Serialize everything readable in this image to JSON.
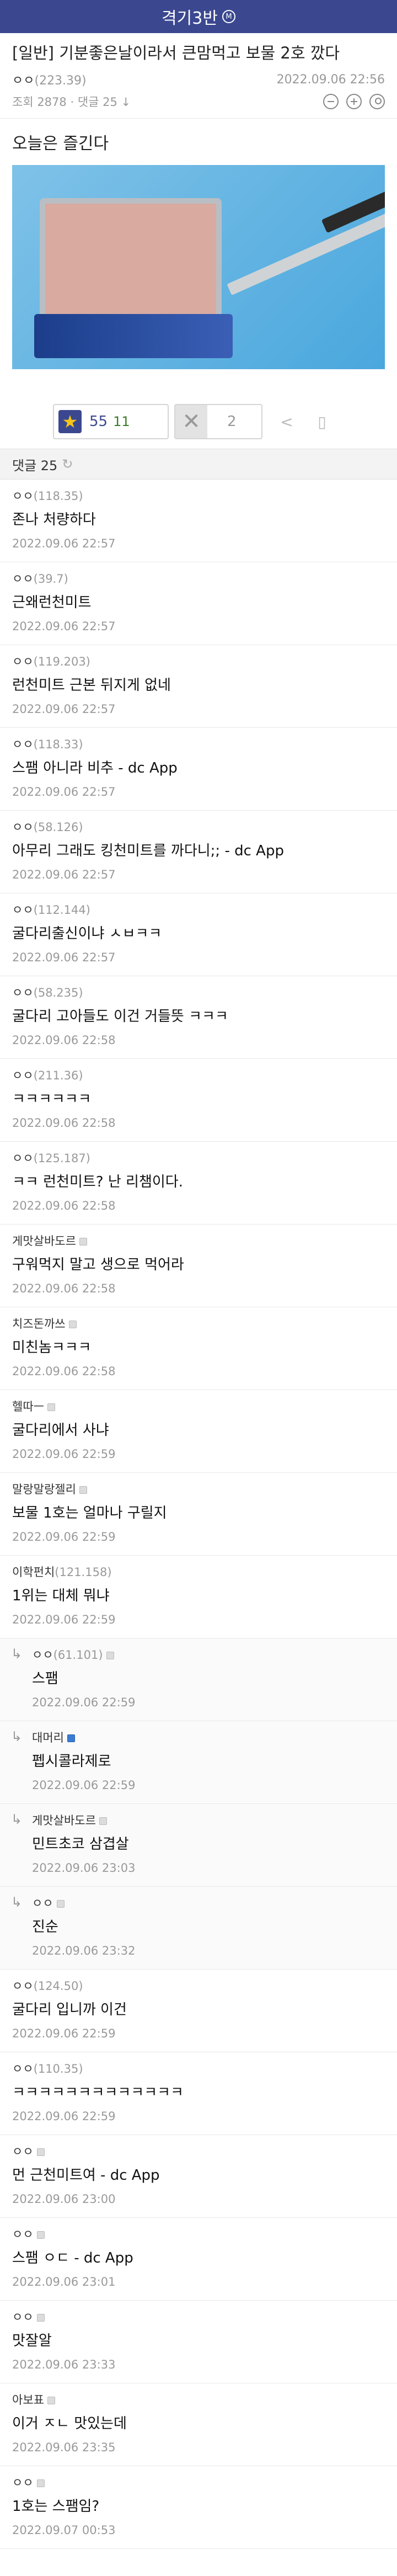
{
  "header": {
    "gallery_name": "격기3반",
    "badge": "M"
  },
  "post": {
    "title": "[일반] 기분좋은날이라서 큰맘먹고 보물 2호 깠다",
    "author": "ㅇㅇ",
    "author_ip": "(223.39)",
    "date": "2022.09.06 22:56",
    "views": "조회 2878",
    "comment_count": "댓글 25",
    "body": "오늘은 즐긴다",
    "photo_icon": "spam-can-photo"
  },
  "votes": {
    "up": "55",
    "fixed": "11",
    "down": "2"
  },
  "comments_header": {
    "label": "댓글 25"
  },
  "comments": [
    {
      "author": "ㅇㅇ",
      "ip": "(118.35)",
      "text": "존나 처량하다",
      "date": "2022.09.06 22:57"
    },
    {
      "author": "ㅇㅇ",
      "ip": "(39.7)",
      "text": "근왜런천미트",
      "date": "2022.09.06 22:57"
    },
    {
      "author": "ㅇㅇ",
      "ip": "(119.203)",
      "text": "런천미트 근본 뒤지게 없네",
      "date": "2022.09.06 22:57"
    },
    {
      "author": "ㅇㅇ",
      "ip": "(118.33)",
      "text": "스팸 아니라 비추 - dc App",
      "date": "2022.09.06 22:57"
    },
    {
      "author": "ㅇㅇ",
      "ip": "(58.126)",
      "text": "아무리 그래도 킹천미트를 까다니;; - dc App",
      "date": "2022.09.06 22:57"
    },
    {
      "author": "ㅇㅇ",
      "ip": "(112.144)",
      "text": "굴다리출신이냐 ㅅㅂㅋㅋ",
      "date": "2022.09.06 22:57"
    },
    {
      "author": "ㅇㅇ",
      "ip": "(58.235)",
      "text": "굴다리 고아들도 이건 거들뜻 ㅋㅋㅋ",
      "date": "2022.09.06 22:58"
    },
    {
      "author": "ㅇㅇ",
      "ip": "(211.36)",
      "text": "ㅋㅋㅋㅋㅋㅋ",
      "date": "2022.09.06 22:58"
    },
    {
      "author": "ㅇㅇ",
      "ip": "(125.187)",
      "text": "ㅋㅋ 런천미트? 난 리챔이다.",
      "date": "2022.09.06 22:58"
    },
    {
      "author": "게맛살바도르",
      "ip": "",
      "badge": "gray",
      "text": "구워먹지 말고 생으로 먹어라",
      "date": "2022.09.06 22:58"
    },
    {
      "author": "치즈돈까쓰",
      "ip": "",
      "badge": "gray",
      "text": "미친놈ㅋㅋㅋ",
      "date": "2022.09.06 22:58"
    },
    {
      "author": "헬따ㅡ",
      "ip": "",
      "badge": "gray",
      "text": "굴다리에서 사냐",
      "date": "2022.09.06 22:59"
    },
    {
      "author": "말랑말랑젤리",
      "ip": "",
      "badge": "gray",
      "text": "보물 1호는 얼마나 구릴지",
      "date": "2022.09.06 22:59"
    },
    {
      "author": "이학펀치",
      "ip": "(121.158)",
      "text": "1위는 대체 뭐냐",
      "date": "2022.09.06 22:59"
    },
    {
      "author": "ㅇㅇ",
      "ip": "(61.101)",
      "badge": "gray",
      "reply": true,
      "text": "스팸",
      "date": "2022.09.06 22:59"
    },
    {
      "author": "대머리",
      "ip": "",
      "badge": "blue",
      "reply": true,
      "text": "펩시콜라제로",
      "date": "2022.09.06 22:59"
    },
    {
      "author": "게맛살바도르",
      "ip": "",
      "badge": "gray",
      "reply": true,
      "text": "민트초코 삼겹살",
      "date": "2022.09.06 23:03"
    },
    {
      "author": "ㅇㅇ",
      "ip": "",
      "badge": "gray",
      "reply": true,
      "text": "진순",
      "date": "2022.09.06 23:32"
    },
    {
      "author": "ㅇㅇ",
      "ip": "(124.50)",
      "text": "굴다리 입니까 이건",
      "date": "2022.09.06 22:59"
    },
    {
      "author": "ㅇㅇ",
      "ip": "(110.35)",
      "text": "ㅋㅋㅋㅋㅋㅋㅋㅋㅋㅋㅋㅋㅋ",
      "date": "2022.09.06 22:59"
    },
    {
      "author": "ㅇㅇ",
      "ip": "",
      "badge": "gray",
      "text": "먼 근천미트여 - dc App",
      "date": "2022.09.06 23:00"
    },
    {
      "author": "ㅇㅇ",
      "ip": "",
      "badge": "gray",
      "text": "스팸 ㅇㄷ - dc App",
      "date": "2022.09.06 23:01"
    },
    {
      "author": "ㅇㅇ",
      "ip": "",
      "badge": "gray",
      "text": "맛잘알",
      "date": "2022.09.06 23:33"
    },
    {
      "author": "아보표",
      "ip": "",
      "badge": "gray",
      "text": "이거 ㅈㄴ 맛있는데",
      "date": "2022.09.06 23:35"
    },
    {
      "author": "ㅇㅇ",
      "ip": "",
      "badge": "gray",
      "text": "1호는 스팸임?",
      "date": "2022.09.07 00:53"
    }
  ]
}
